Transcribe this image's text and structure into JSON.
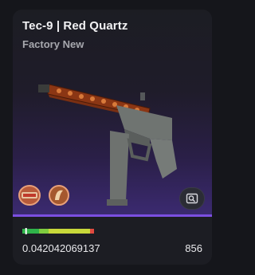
{
  "item": {
    "title": "Tec-9 | Red Quartz",
    "exterior": "Factory New",
    "float_value": "0.042042069137",
    "price": "856",
    "float_fraction": 0.042
  },
  "stickers": [
    {
      "icon": "sticker-icon"
    },
    {
      "icon": "sticker-icon"
    }
  ],
  "inspect": {
    "icon": "inspect-icon"
  },
  "colors": {
    "accent": "#7b4fe1",
    "wear_factory_new": "#2fb34a",
    "wear_minimal": "#7fcc3f",
    "wear_field_tested": "#c8d83a",
    "wear_battle_scarred": "#e04a3f"
  }
}
